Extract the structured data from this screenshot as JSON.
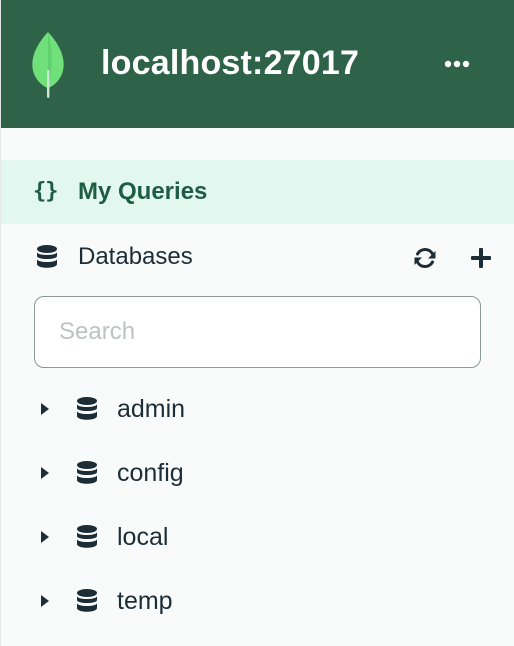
{
  "header": {
    "title": "localhost:27017",
    "logo_icon": "mongodb-leaf-icon",
    "menu_icon": "ellipsis-icon",
    "background_color": "#2e6249"
  },
  "queries": {
    "icon": "{}",
    "label": "My Queries",
    "accent_color": "#1f5c45",
    "highlight_color": "#e3f7f1"
  },
  "databases": {
    "label": "Databases",
    "icon": "database-icon",
    "refresh_icon": "refresh-icon",
    "add_icon": "plus-icon"
  },
  "search": {
    "placeholder": "Search",
    "value": ""
  },
  "db_items": [
    {
      "name": "admin",
      "icon": "database-icon",
      "expand_icon": "caret-right-icon"
    },
    {
      "name": "config",
      "icon": "database-icon",
      "expand_icon": "caret-right-icon"
    },
    {
      "name": "local",
      "icon": "database-icon",
      "expand_icon": "caret-right-icon"
    },
    {
      "name": "temp",
      "icon": "database-icon",
      "expand_icon": "caret-right-icon"
    }
  ]
}
